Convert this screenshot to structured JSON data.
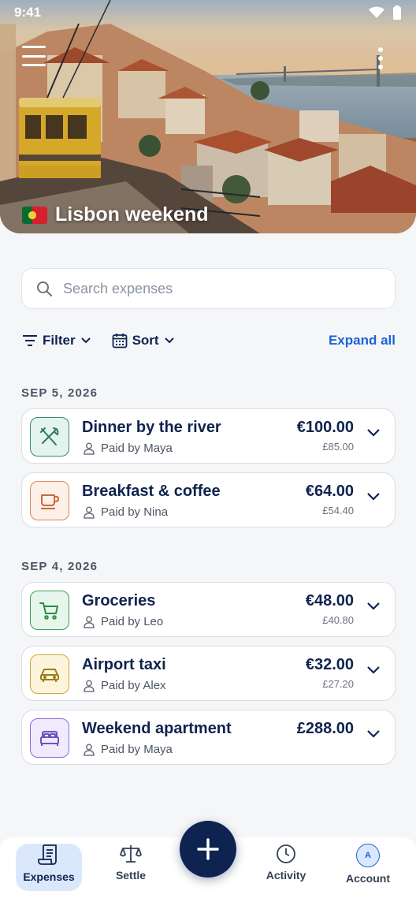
{
  "status_bar": {
    "time": "9:41"
  },
  "trip": {
    "title": "Lisbon weekend"
  },
  "search": {
    "placeholder": "Search expenses"
  },
  "toolbar": {
    "filter_label": "Filter",
    "sort_label": "Sort",
    "expand_label": "Expand all"
  },
  "groups": [
    {
      "date": "SEP 5, 2026",
      "expenses": [
        {
          "name": "Dinner by the river",
          "payer": "Paid by Maya",
          "amount": "€100.00",
          "converted": "£85.00",
          "icon": "utensils-icon",
          "color": "#3b8a6c"
        },
        {
          "name": "Breakfast & coffee",
          "payer": "Paid by Nina",
          "amount": "€64.00",
          "converted": "£54.40",
          "icon": "coffee-cup-icon",
          "color": "#d8855b"
        }
      ]
    },
    {
      "date": "SEP 4, 2026",
      "expenses": [
        {
          "name": "Groceries",
          "payer": "Paid by Leo",
          "amount": "€48.00",
          "converted": "£40.80",
          "icon": "shopping-cart-icon",
          "color": "#3f9f57"
        },
        {
          "name": "Airport taxi",
          "payer": "Paid by Alex",
          "amount": "€32.00",
          "converted": "£27.20",
          "icon": "car-icon",
          "color": "#c9a646"
        },
        {
          "name": "Weekend apartment",
          "payer": "Paid by Maya",
          "amount": "£288.00",
          "converted": "",
          "icon": "bed-icon",
          "color": "#8c6cd8"
        }
      ]
    }
  ],
  "nav": {
    "expenses": "Expenses",
    "settle": "Settle",
    "activity": "Activity",
    "account": "Account",
    "account_initial": "A"
  },
  "colors": {
    "primary": "#0f2350",
    "accent": "#1d63d8"
  }
}
